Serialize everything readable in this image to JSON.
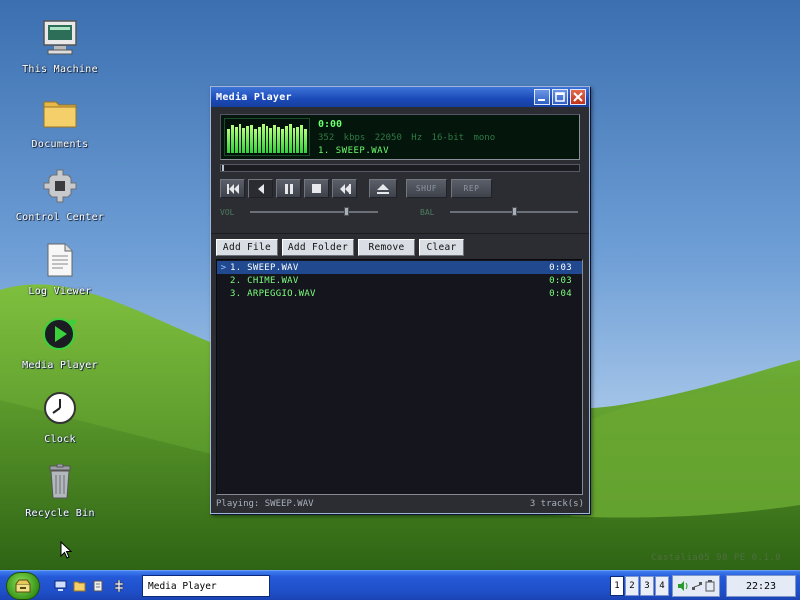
{
  "desktop": {
    "icons": [
      {
        "label": "This Machine",
        "icon": "computer-icon"
      },
      {
        "label": "Documents",
        "icon": "folder-icon"
      },
      {
        "label": "Control Center",
        "icon": "gear-icon"
      },
      {
        "label": "Log Viewer",
        "icon": "document-icon"
      },
      {
        "label": "Media Player",
        "icon": "media-player-icon"
      },
      {
        "label": "Clock",
        "icon": "clock-icon"
      },
      {
        "label": "Recycle Bin",
        "icon": "trash-icon"
      }
    ],
    "watermark": "Castalia05 98 PE  0.1.0"
  },
  "window": {
    "title": "Media Player",
    "lcd": {
      "time": "0:00",
      "info": "352 kbps  22050 Hz  16-bit  mono",
      "track": "1. SWEEP.WAV",
      "progress": 0
    },
    "transport": {
      "shuffle_label": "SHUF",
      "repeat_label": "REP",
      "vol_label": "VOL",
      "bal_label": "BAL",
      "volume": 0.75,
      "balance": 0.5
    },
    "playlist_buttons": {
      "add_file": "Add File",
      "add_folder": "Add Folder",
      "remove": "Remove",
      "clear": "Clear"
    },
    "playlist": [
      {
        "title": "1. SWEEP.WAV",
        "duration": "0:03",
        "selected": true,
        "marker": ">"
      },
      {
        "title": "2. CHIME.WAV",
        "duration": "0:03",
        "selected": false,
        "marker": ""
      },
      {
        "title": "3. ARPEGGIO.WAV",
        "duration": "0:04",
        "selected": false,
        "marker": ""
      }
    ],
    "status": {
      "playing": "Playing: SWEEP.WAV",
      "count": "3 track(s)"
    }
  },
  "taskbar": {
    "task_label": "Media Player",
    "workspaces": [
      "1",
      "2",
      "3",
      "4"
    ],
    "active_workspace": "1",
    "clock": "22:23"
  },
  "colors": {
    "lcd_green": "#6dff6d",
    "title_blue": "#1b4ab8",
    "selection_blue": "#20498f",
    "taskbar_blue": "#2559d8"
  }
}
